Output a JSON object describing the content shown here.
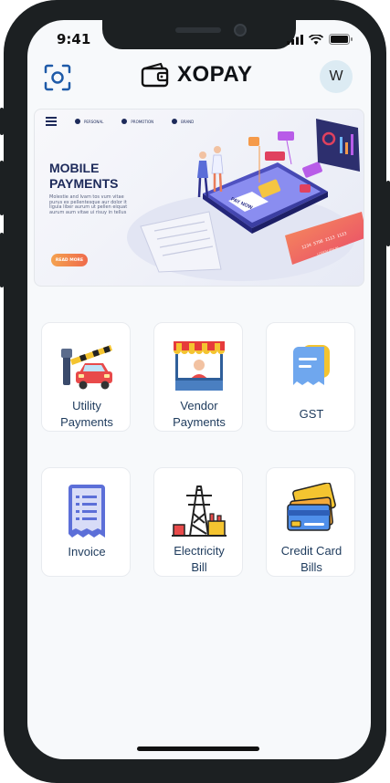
{
  "status_bar": {
    "time": "9:41"
  },
  "header": {
    "app_name": "XOPAY",
    "avatar_initial": "W",
    "scan_icon": "scan-icon",
    "wallet_icon": "wallet-icon"
  },
  "banner": {
    "nav": [
      "PERSONAL",
      "PROMOTION",
      "BRAND"
    ],
    "title_line1": "MOBILE",
    "title_line2": "PAYMENTS",
    "description": "Molestie and Ivam tos vum vitae purus ex pellentesque aur dolor it ligula liber aurum ut pellen eiquat aurum aum vitae ui risuy in tellus",
    "button_label": "READ MORE",
    "pay_now": "PAY NOW",
    "card_number": "1234 5798 2113 1123",
    "card_label": "LOREM IPSUM"
  },
  "services": [
    {
      "line1": "Utility",
      "line2": "Payments",
      "icon": "toll-gate-car-icon"
    },
    {
      "line1": "Vendor",
      "line2": "Payments",
      "icon": "vendor-stall-icon"
    },
    {
      "line1": "GST",
      "line2": "",
      "icon": "receipt-icon"
    },
    {
      "line1": "Invoice",
      "line2": "",
      "icon": "invoice-icon"
    },
    {
      "line1": "Electricity",
      "line2": "Bill",
      "icon": "power-tower-icon"
    },
    {
      "line1": "Credit Card",
      "line2": "Bills",
      "icon": "credit-cards-icon"
    }
  ],
  "colors": {
    "accent": "#1e5aa8",
    "label": "#1d3a5c",
    "banner_title": "#1d2a5a",
    "avatar_bg": "#dcebf3",
    "screen_bg": "#f7f9fb"
  }
}
